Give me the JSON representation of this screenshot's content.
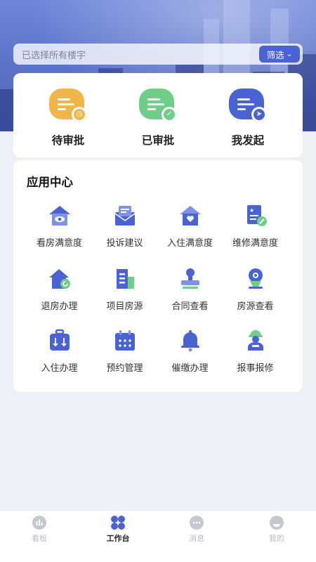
{
  "search": {
    "placeholder": "已选择所有楼宇",
    "filter_label": "筛选"
  },
  "approvals": [
    {
      "label": "待审批",
      "icon": "pending-approval-icon",
      "color": "#f0b64a",
      "badge": "clock"
    },
    {
      "label": "已审批",
      "icon": "approved-icon",
      "color": "#6fcf8a",
      "badge": "check"
    },
    {
      "label": "我发起",
      "icon": "initiated-icon",
      "color": "#4a63d3",
      "badge": "send"
    }
  ],
  "apps": {
    "title": "应用中心",
    "items": [
      {
        "label": "看房满意度",
        "icon": "house-eye-icon"
      },
      {
        "label": "投诉建议",
        "icon": "mail-complaint-icon"
      },
      {
        "label": "入住满意度",
        "icon": "house-heart-icon"
      },
      {
        "label": "维修满意度",
        "icon": "repair-doc-icon"
      },
      {
        "label": "退房办理",
        "icon": "house-return-icon"
      },
      {
        "label": "项目房源",
        "icon": "building-icon"
      },
      {
        "label": "合同查看",
        "icon": "stamp-icon"
      },
      {
        "label": "房源查看",
        "icon": "location-view-icon"
      },
      {
        "label": "入住办理",
        "icon": "luggage-icon"
      },
      {
        "label": "预约管理",
        "icon": "calendar-icon"
      },
      {
        "label": "催缴办理",
        "icon": "bell-icon"
      },
      {
        "label": "报事报修",
        "icon": "worker-icon"
      }
    ]
  },
  "tabbar": [
    {
      "label": "看板",
      "icon": "dashboard-icon",
      "active": false
    },
    {
      "label": "工作台",
      "icon": "workbench-icon",
      "active": true
    },
    {
      "label": "消息",
      "icon": "message-icon",
      "active": false
    },
    {
      "label": "我的",
      "icon": "profile-icon",
      "active": false
    }
  ],
  "colors": {
    "primary": "#4a63d3",
    "primary_light": "#7f93e6",
    "inactive": "#c5c8d0"
  }
}
